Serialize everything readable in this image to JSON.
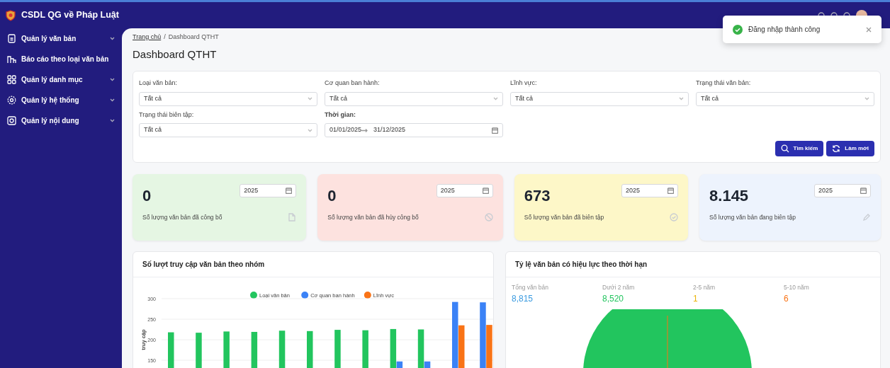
{
  "app": {
    "title": "CSDL QG về Pháp Luật"
  },
  "sidebar": {
    "items": [
      {
        "label": "Quản lý văn bản",
        "expandable": true
      },
      {
        "label": "Báo cáo theo loại văn bản",
        "expandable": false
      },
      {
        "label": "Quản lý danh mục",
        "expandable": true
      },
      {
        "label": "Quản lý hệ thống",
        "expandable": true
      },
      {
        "label": "Quản lý nội dung",
        "expandable": true
      }
    ]
  },
  "toast": {
    "message": "Đăng nhập thành công"
  },
  "breadcrumb": {
    "separator": "/",
    "items": [
      {
        "label": "Trang chủ",
        "link": true
      },
      {
        "label": "Dashboard QTHT",
        "link": false
      }
    ]
  },
  "page_title": "Dashboard QTHT",
  "filters": [
    {
      "kind": "select",
      "label": "Loại văn bản:",
      "bold": false,
      "value": "Tất cả"
    },
    {
      "kind": "select",
      "label": "Cơ quan ban hành:",
      "bold": false,
      "value": "Tất cả"
    },
    {
      "kind": "select",
      "label": "Lĩnh vực:",
      "bold": false,
      "value": "Tất cả"
    },
    {
      "kind": "select",
      "label": "Trạng thái văn bản:",
      "bold": false,
      "value": "Tất cả"
    },
    {
      "kind": "select",
      "label": "Trạng thái biên tập:",
      "bold": false,
      "value": "Tất cả"
    },
    {
      "kind": "daterange",
      "label": "Thời gian:",
      "bold": true,
      "from": "01/01/2025",
      "to": "31/12/2025"
    }
  ],
  "buttons": [
    {
      "label": "Tìm kiếm"
    },
    {
      "label": "Làm mới"
    }
  ],
  "stats": [
    {
      "value": "0",
      "year": "2025",
      "label": "Số lượng văn bản đã công bố",
      "color": "#e5f6e3"
    },
    {
      "value": "0",
      "year": "2025",
      "label": "Số lượng văn bản đã hủy công bố",
      "color": "#fde2df"
    },
    {
      "value": "673",
      "year": "2025",
      "label": "Số lượng văn bản đã biên tập",
      "color": "#fdf7c8"
    },
    {
      "value": "8.145",
      "year": "2025",
      "label": "Số lượng văn bản đang biên tập",
      "color": "#edf3fd"
    }
  ],
  "access_chart": {
    "title": "Số lượt truy cập văn bản theo nhóm",
    "chart_data": {
      "type": "bar",
      "ylabel": "truy cập",
      "ylim": [
        0,
        300
      ],
      "yticks": [
        150,
        200,
        250,
        300
      ],
      "grid": true,
      "legend": true,
      "stacked": false,
      "series": [
        {
          "name": "Loại văn bản",
          "color": "#22c55e",
          "values": [
            218,
            217,
            220,
            219,
            222,
            221,
            224,
            223,
            226,
            225,
            null,
            null
          ]
        },
        {
          "name": "Cơ quan ban hành",
          "color": "#3b82f6",
          "values": [
            null,
            null,
            null,
            null,
            null,
            null,
            null,
            null,
            147,
            147,
            292,
            291
          ]
        },
        {
          "name": "Lĩnh vực",
          "color": "#f97316",
          "values": [
            null,
            null,
            null,
            null,
            null,
            null,
            null,
            null,
            null,
            null,
            235,
            236
          ]
        }
      ]
    }
  },
  "validity_chart": {
    "title": "Tỷ lệ văn bản có hiệu lực theo thời hạn",
    "summary": [
      {
        "label": "Tổng văn bản",
        "value": "8,815",
        "color": "#3b9be0"
      },
      {
        "label": "Dưới 2 năm",
        "value": "8,520",
        "color": "#22c55e"
      },
      {
        "label": "2-5 năm",
        "value": "1",
        "color": "#eab308"
      },
      {
        "label": "5-10 năm",
        "value": "6",
        "color": "#f97316"
      }
    ]
  }
}
